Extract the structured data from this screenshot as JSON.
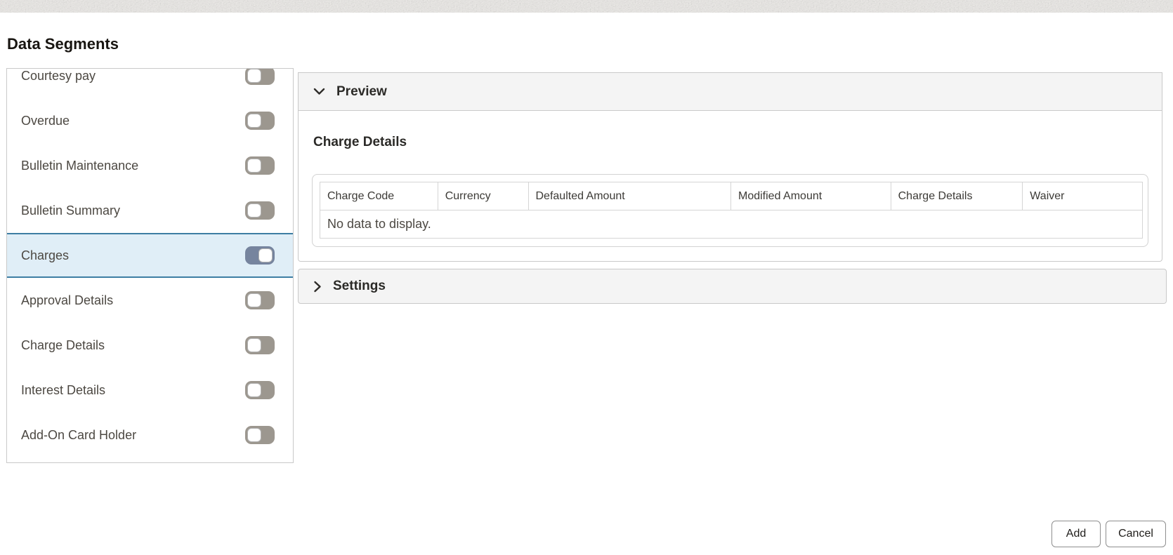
{
  "title": "Data Segments",
  "segments": {
    "items": [
      {
        "label": "Courtesy pay",
        "on": false,
        "selected": false
      },
      {
        "label": "Overdue",
        "on": false,
        "selected": false
      },
      {
        "label": "Bulletin Maintenance",
        "on": false,
        "selected": false
      },
      {
        "label": "Bulletin Summary",
        "on": false,
        "selected": false
      },
      {
        "label": "Charges",
        "on": true,
        "selected": true
      },
      {
        "label": "Approval Details",
        "on": false,
        "selected": false
      },
      {
        "label": "Charge Details",
        "on": false,
        "selected": false
      },
      {
        "label": "Interest Details",
        "on": false,
        "selected": false
      },
      {
        "label": "Add-On Card Holder",
        "on": false,
        "selected": false
      }
    ]
  },
  "preview": {
    "label": "Preview",
    "expanded": true,
    "section_title": "Charge Details",
    "table": {
      "columns": [
        "Charge Code",
        "Currency",
        "Defaulted Amount",
        "Modified Amount",
        "Charge Details",
        "Waiver"
      ],
      "rows": [],
      "empty_message": "No data to display."
    }
  },
  "settings": {
    "label": "Settings",
    "expanded": false
  },
  "actions": {
    "add": "Add",
    "cancel": "Cancel"
  },
  "icons": {
    "preview_chevron": "chevron-down-icon",
    "settings_chevron": "chevron-right-icon"
  },
  "colors": {
    "selected_row_bg": "#e0eef7",
    "selected_row_border": "#3d7ea3",
    "toggle_on_track": "#76849e",
    "toggle_off_track": "#9c978f",
    "accordion_header_bg": "#f4f4f4",
    "panel_border": "#c9c9c9"
  }
}
